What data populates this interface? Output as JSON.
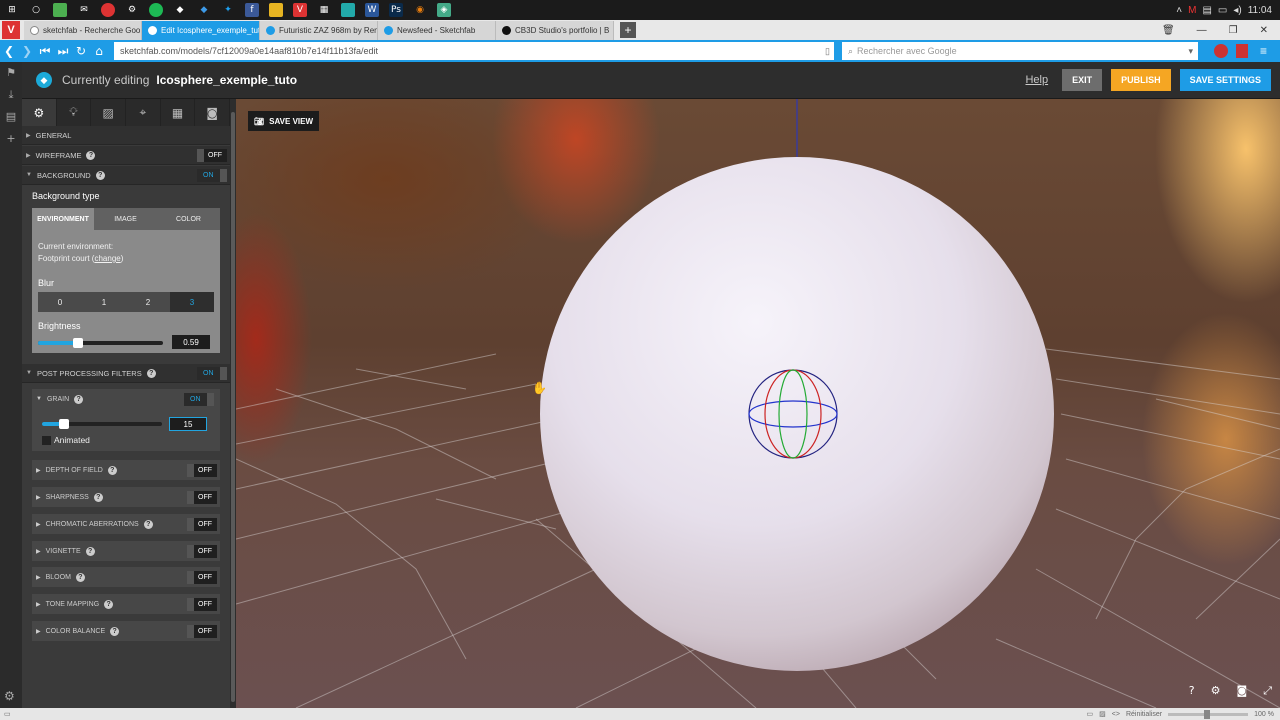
{
  "taskbar": {
    "clock": "11:04"
  },
  "tabs": [
    {
      "label": "sketchfab - Recherche Goo"
    },
    {
      "label": "Edit Icosphere_exemple_tut"
    },
    {
      "label": "Futuristic ZAZ 968m by Ren"
    },
    {
      "label": "Newsfeed - Sketchfab"
    },
    {
      "label": "CB3D Studio's portfolio | B"
    }
  ],
  "address": {
    "url": "sketchfab.com/models/7cf12009a0e14aaf810b7e14f11b13fa/edit",
    "search_placeholder": "Rechercher avec Google"
  },
  "header": {
    "currently_editing": "Currently editing",
    "model_name": "Icosphere_exemple_tuto",
    "help": "Help",
    "exit": "EXIT",
    "publish": "PUBLISH",
    "save_settings": "SAVE SETTINGS",
    "colors": {
      "publish": "#f5a623",
      "save": "#1e9ce6"
    }
  },
  "panel": {
    "sections": {
      "general": "GENERAL",
      "wireframe": "WIREFRAME",
      "wireframe_state": "OFF",
      "background": "BACKGROUND",
      "background_state": "ON",
      "post": "POST PROCESSING FILTERS",
      "post_state": "ON"
    },
    "background": {
      "type_label": "Background type",
      "tabs": [
        "ENVIRONMENT",
        "IMAGE",
        "COLOR"
      ],
      "selected_tab": "ENVIRONMENT",
      "env_line1": "Current environment:",
      "env_line2": "Footprint court (",
      "env_change": "change",
      "env_close": ")",
      "blur_label": "Blur",
      "blur_options": [
        "0",
        "1",
        "2",
        "3"
      ],
      "blur_selected": "3",
      "brightness_label": "Brightness",
      "brightness_value": "0.59"
    },
    "grain": {
      "label": "GRAIN",
      "state": "ON",
      "value": "15",
      "animated_label": "Animated"
    },
    "filters": [
      {
        "label": "DEPTH OF FIELD",
        "state": "OFF"
      },
      {
        "label": "SHARPNESS",
        "state": "OFF"
      },
      {
        "label": "CHROMATIC ABERRATIONS",
        "state": "OFF"
      },
      {
        "label": "VIGNETTE",
        "state": "OFF"
      },
      {
        "label": "BLOOM",
        "state": "OFF"
      },
      {
        "label": "TONE MAPPING",
        "state": "OFF"
      },
      {
        "label": "COLOR BALANCE",
        "state": "OFF"
      }
    ]
  },
  "viewport": {
    "save_view": "SAVE VIEW"
  },
  "statusbar": {
    "reset": "Réinitialiser",
    "zoom": "100 %"
  }
}
